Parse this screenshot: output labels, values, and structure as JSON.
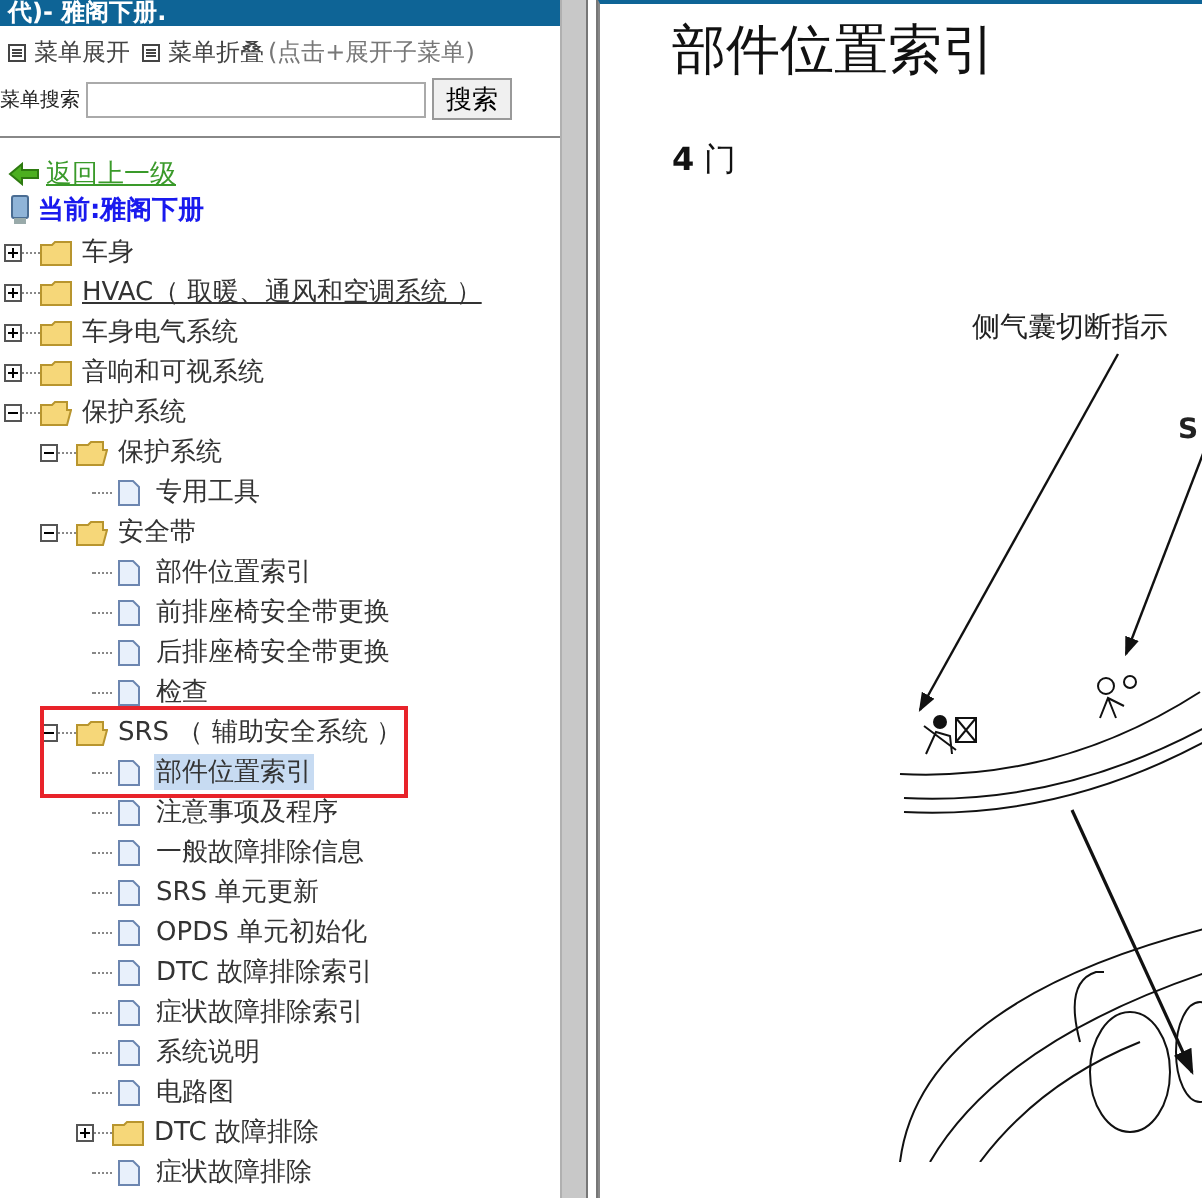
{
  "window": {
    "title": "代)- 雅阁下册."
  },
  "menu_controls": [
    {
      "label": "菜单展开"
    },
    {
      "label": "菜单折叠"
    }
  ],
  "menu_hint": "(点击+展开子菜单)",
  "search": {
    "label": "菜单搜索",
    "button": "搜索"
  },
  "back_link": "返回上一级",
  "current": "当前:雅阁下册",
  "tree": [
    {
      "kind": "folder",
      "label": "车身",
      "expanded": false,
      "hovered": false
    },
    {
      "kind": "folder",
      "label": "HVAC（ 取暖、通风和空调系统 ）",
      "expanded": false,
      "hovered": true
    },
    {
      "kind": "folder",
      "label": "车身电气系统",
      "expanded": false,
      "hovered": false
    },
    {
      "kind": "folder",
      "label": "音响和可视系统",
      "expanded": false,
      "hovered": false
    },
    {
      "kind": "folder",
      "label": "保护系统",
      "expanded": true,
      "hovered": false,
      "children": [
        {
          "kind": "folder",
          "label": "保护系统",
          "expanded": true,
          "hovered": false,
          "children": [
            {
              "kind": "doc",
              "label": "专用工具",
              "selected": false
            }
          ]
        },
        {
          "kind": "folder",
          "label": "安全带",
          "expanded": true,
          "hovered": false,
          "children": [
            {
              "kind": "doc",
              "label": "部件位置索引",
              "selected": false
            },
            {
              "kind": "doc",
              "label": "前排座椅安全带更换",
              "selected": false
            },
            {
              "kind": "doc",
              "label": "后排座椅安全带更换",
              "selected": false
            },
            {
              "kind": "doc",
              "label": "检查",
              "selected": false
            }
          ]
        },
        {
          "kind": "folder",
          "label": "SRS （ 辅助安全系统 ）",
          "expanded": true,
          "hovered": false,
          "highlighted": true,
          "children": [
            {
              "kind": "doc",
              "label": "部件位置索引",
              "selected": true,
              "highlighted": true
            },
            {
              "kind": "doc",
              "label": "注意事项及程序",
              "selected": false
            },
            {
              "kind": "doc",
              "label": "一般故障排除信息",
              "selected": false
            },
            {
              "kind": "doc",
              "label": "SRS 单元更新",
              "selected": false
            },
            {
              "kind": "doc",
              "label": "OPDS 单元初始化",
              "selected": false
            },
            {
              "kind": "doc",
              "label": "DTC 故障排除索引",
              "selected": false
            },
            {
              "kind": "doc",
              "label": "症状故障排除索引",
              "selected": false
            },
            {
              "kind": "doc",
              "label": "系统说明",
              "selected": false
            },
            {
              "kind": "doc",
              "label": "电路图",
              "selected": false
            },
            {
              "kind": "folder",
              "label": "DTC 故障排除",
              "expanded": false,
              "hovered": false
            },
            {
              "kind": "doc",
              "label": "症状故障排除",
              "selected": false
            }
          ]
        }
      ]
    }
  ],
  "document": {
    "title": "部件位置索引",
    "subtitle_number": "4",
    "subtitle": "门",
    "callouts": [
      {
        "label": "侧气囊切断指示"
      },
      {
        "label": "S"
      }
    ]
  }
}
